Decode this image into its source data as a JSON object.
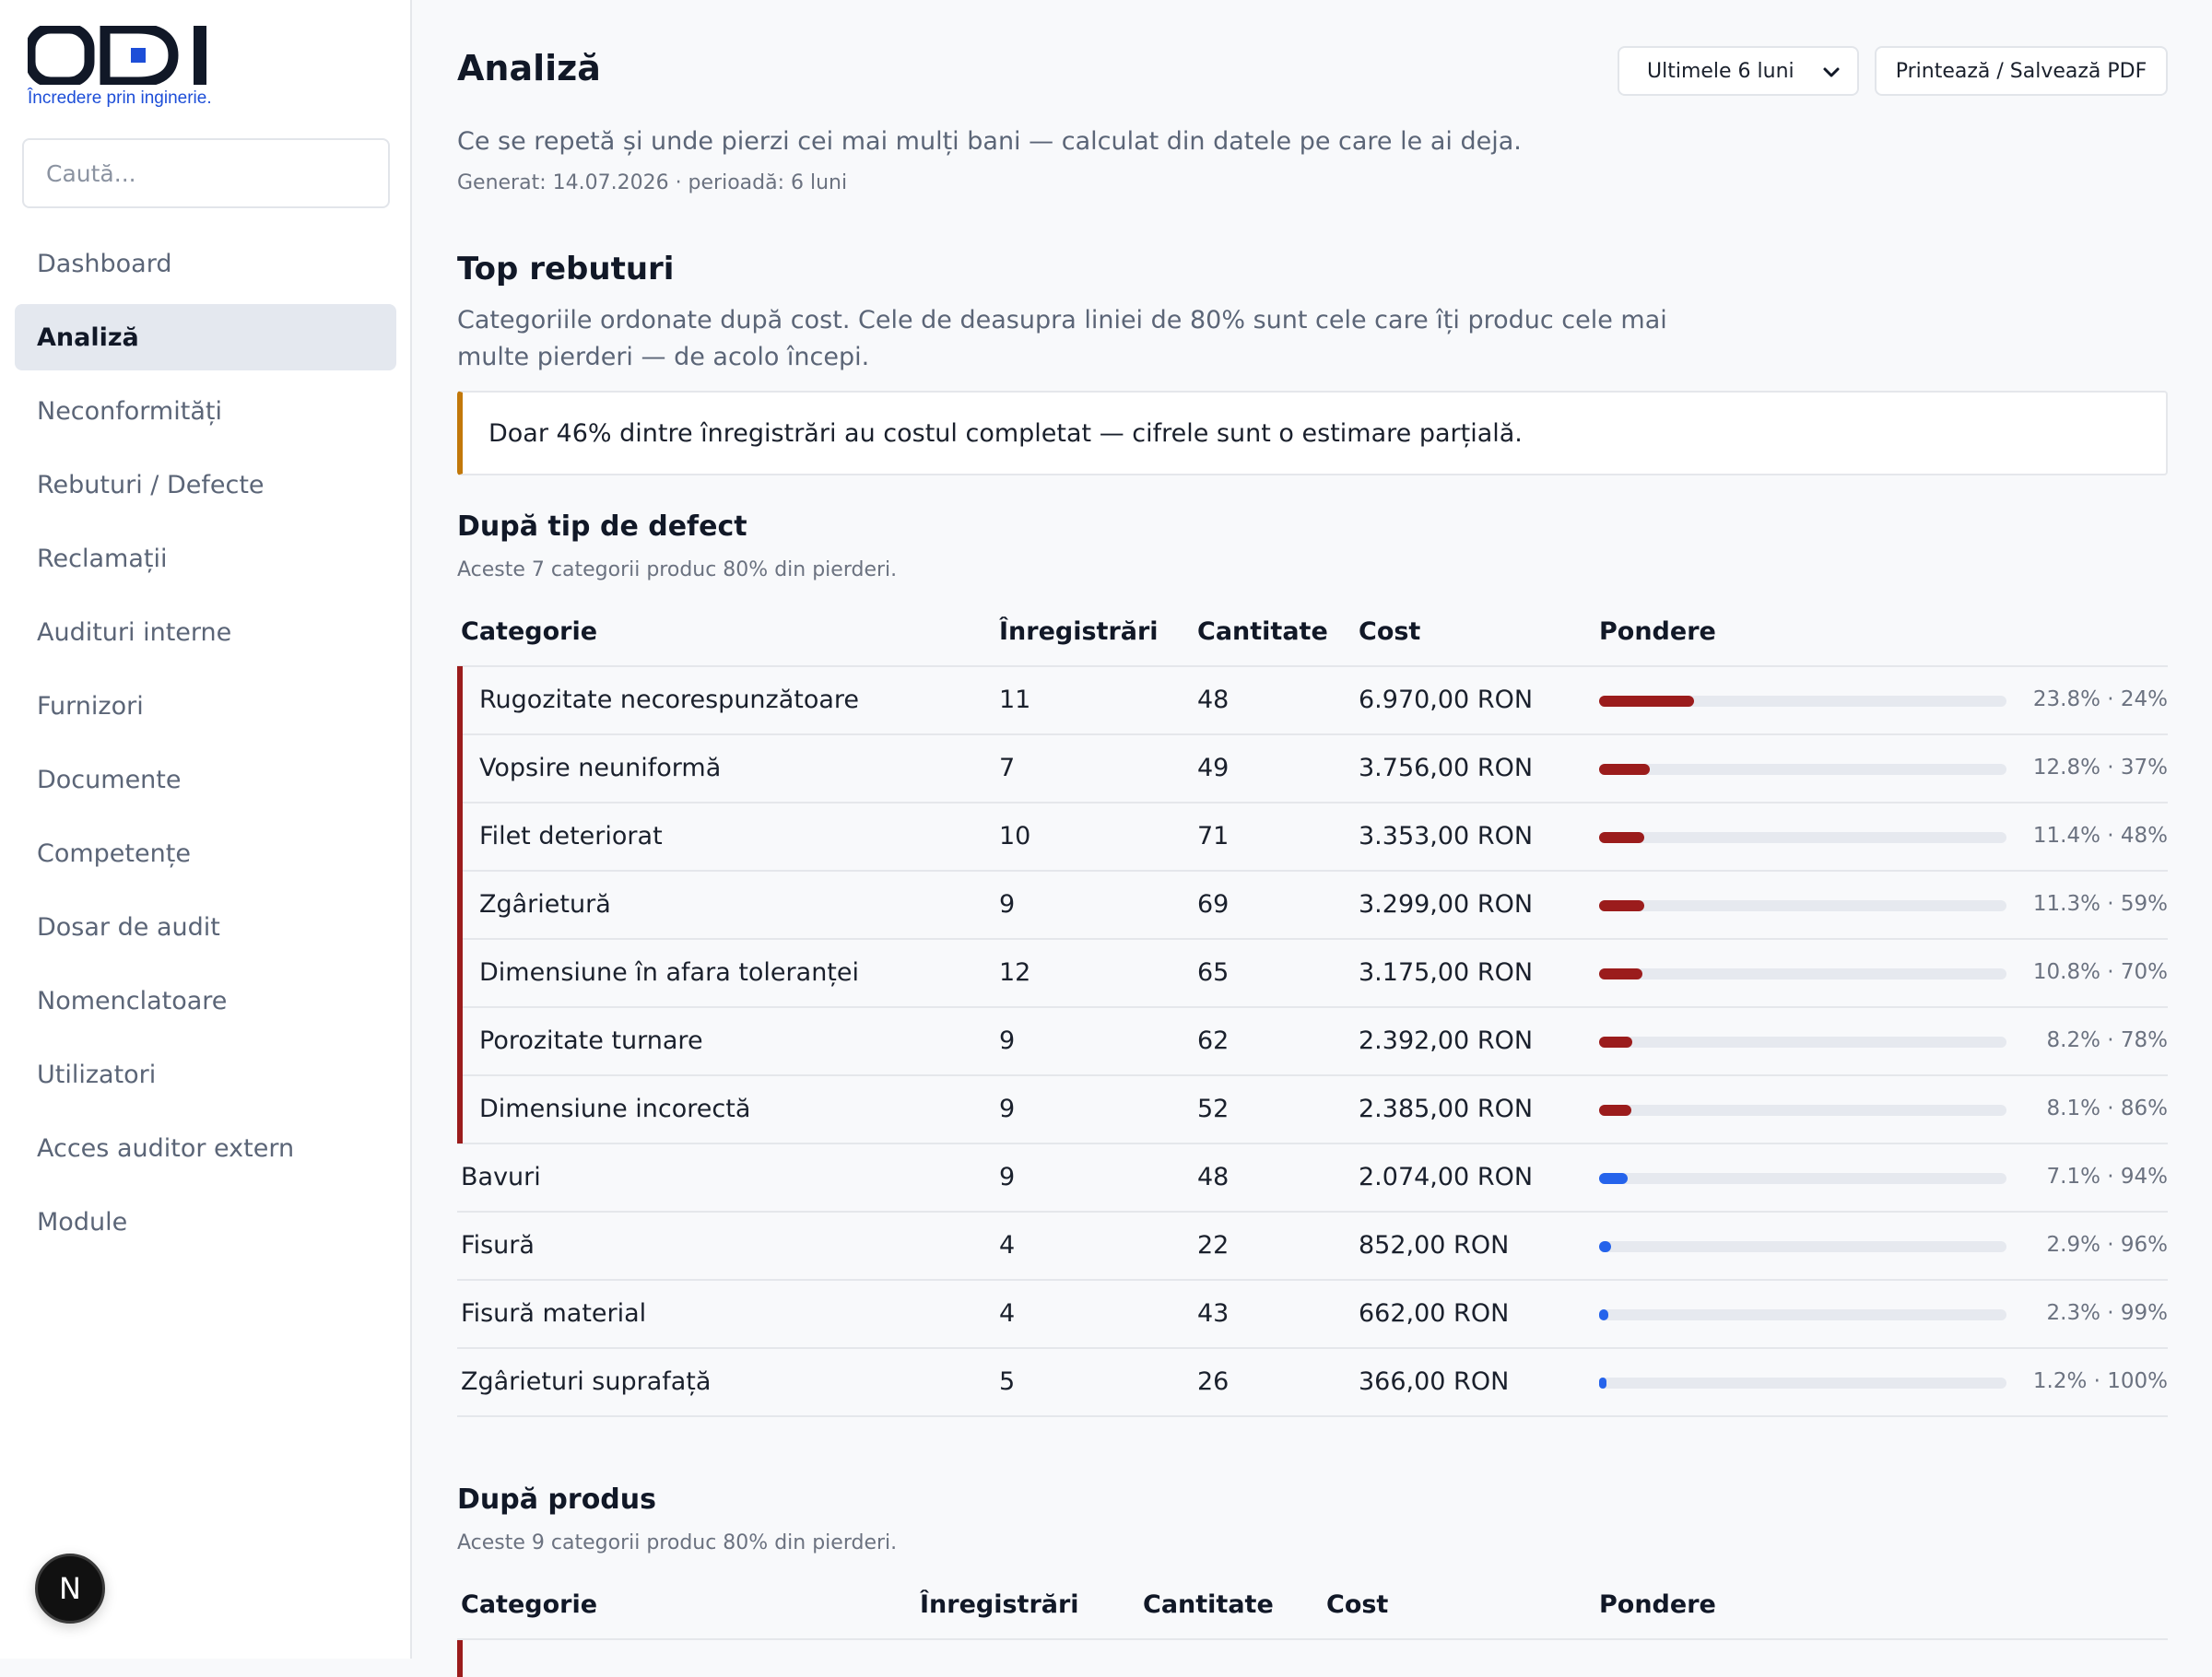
{
  "brand": {
    "name": "ODI",
    "tagline": "Încredere prin inginerie."
  },
  "search": {
    "placeholder": "Caută..."
  },
  "nav": [
    {
      "label": "Dashboard",
      "active": false
    },
    {
      "label": "Analiză",
      "active": true
    },
    {
      "label": "Neconformități",
      "active": false
    },
    {
      "label": "Rebuturi / Defecte",
      "active": false
    },
    {
      "label": "Reclamații",
      "active": false
    },
    {
      "label": "Audituri interne",
      "active": false
    },
    {
      "label": "Furnizori",
      "active": false
    },
    {
      "label": "Documente",
      "active": false
    },
    {
      "label": "Competențe",
      "active": false
    },
    {
      "label": "Dosar de audit",
      "active": false
    },
    {
      "label": "Nomenclatoare",
      "active": false
    },
    {
      "label": "Utilizatori",
      "active": false
    },
    {
      "label": "Acces auditor extern",
      "active": false
    },
    {
      "label": "Module",
      "active": false
    }
  ],
  "avatar": {
    "initial": "N"
  },
  "header": {
    "title": "Analiză",
    "period": "Ultimele 6 luni",
    "print_label": "Printează / Salvează PDF",
    "intro": "Ce se repetă și unde pierzi cei mai mulți bani — calculat din datele pe care le ai deja.",
    "generated": "Generat: 14.07.2026 · perioadă: 6 luni"
  },
  "top_rebuturi": {
    "title": "Top rebuturi",
    "description": "Categoriile ordonate după cost. Cele de deasupra liniei de 80% sunt cele care îți produc cele mai multe pierderi — de acolo începi.",
    "notice": "Doar 46% dintre înregistrări au costul completat — cifrele sunt o estimare parțială."
  },
  "colors": {
    "top80_bar": "#9b1c1c",
    "other_bar": "#2563eb",
    "notice_accent": "#c2780a",
    "track": "#e6e9ef"
  },
  "by_defect": {
    "title": "După tip de defect",
    "subtitle": "Aceste 7 categorii produc 80% din pierderi.",
    "columns": {
      "category": "Categorie",
      "records": "Înregistrări",
      "quantity": "Cantitate",
      "cost": "Cost",
      "share": "Pondere"
    },
    "rows": [
      {
        "category": "Rugozitate necorespunzătoare",
        "records": "11",
        "quantity": "48",
        "cost": "6.970,00 RON",
        "share": 23.8,
        "pct_label": "23.8% · 24%",
        "top80": true
      },
      {
        "category": "Vopsire neuniformă",
        "records": "7",
        "quantity": "49",
        "cost": "3.756,00 RON",
        "share": 12.8,
        "pct_label": "12.8% · 37%",
        "top80": true
      },
      {
        "category": "Filet deteriorat",
        "records": "10",
        "quantity": "71",
        "cost": "3.353,00 RON",
        "share": 11.4,
        "pct_label": "11.4% · 48%",
        "top80": true
      },
      {
        "category": "Zgârietură",
        "records": "9",
        "quantity": "69",
        "cost": "3.299,00 RON",
        "share": 11.3,
        "pct_label": "11.3% · 59%",
        "top80": true
      },
      {
        "category": "Dimensiune în afara toleranței",
        "records": "12",
        "quantity": "65",
        "cost": "3.175,00 RON",
        "share": 10.8,
        "pct_label": "10.8% · 70%",
        "top80": true
      },
      {
        "category": "Porozitate turnare",
        "records": "9",
        "quantity": "62",
        "cost": "2.392,00 RON",
        "share": 8.2,
        "pct_label": "8.2% · 78%",
        "top80": true
      },
      {
        "category": "Dimensiune incorectă",
        "records": "9",
        "quantity": "52",
        "cost": "2.385,00 RON",
        "share": 8.1,
        "pct_label": "8.1% · 86%",
        "top80": true
      },
      {
        "category": "Bavuri",
        "records": "9",
        "quantity": "48",
        "cost": "2.074,00 RON",
        "share": 7.1,
        "pct_label": "7.1% · 94%",
        "top80": false
      },
      {
        "category": "Fisură",
        "records": "4",
        "quantity": "22",
        "cost": "852,00 RON",
        "share": 2.9,
        "pct_label": "2.9% · 96%",
        "top80": false
      },
      {
        "category": "Fisură material",
        "records": "4",
        "quantity": "43",
        "cost": "662,00 RON",
        "share": 2.3,
        "pct_label": "2.3% · 99%",
        "top80": false
      },
      {
        "category": "Zgârieturi suprafață",
        "records": "5",
        "quantity": "26",
        "cost": "366,00 RON",
        "share": 1.2,
        "pct_label": "1.2% · 100%",
        "top80": false
      }
    ]
  },
  "by_product": {
    "title": "După produs",
    "subtitle": "Aceste 9 categorii produc 80% din pierderi.",
    "columns": {
      "category": "Categorie",
      "records": "Înregistrări",
      "quantity": "Cantitate",
      "cost": "Cost",
      "share": "Pondere"
    }
  }
}
